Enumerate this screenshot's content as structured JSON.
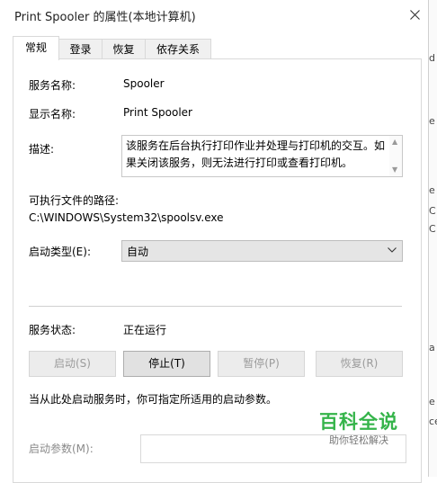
{
  "window": {
    "title": "Print Spooler 的属性(本地计算机)"
  },
  "tabs": [
    {
      "label": "常规",
      "active": true
    },
    {
      "label": "登录",
      "active": false
    },
    {
      "label": "恢复",
      "active": false
    },
    {
      "label": "依存关系",
      "active": false
    }
  ],
  "general": {
    "service_name_label": "服务名称:",
    "service_name": "Spooler",
    "display_name_label": "显示名称:",
    "display_name": "Print Spooler",
    "description_label": "描述:",
    "description": "该服务在后台执行打印作业并处理与打印机的交互。如果关闭该服务，则无法进行打印或查看打印机。",
    "exec_path_label": "可执行文件的路径:",
    "exec_path": "C:\\WINDOWS\\System32\\spoolsv.exe",
    "startup_type_label": "启动类型(E):",
    "startup_type": "自动",
    "status_label": "服务状态:",
    "status": "正在运行",
    "buttons": {
      "start": "启动(S)",
      "stop": "停止(T)",
      "pause": "暂停(P)",
      "resume": "恢复(R)"
    },
    "hint": "当从此处启动服务时，你可指定所适用的启动参数。",
    "params_label": "启动参数(M):",
    "params_value": ""
  },
  "watermark": {
    "title": "百科全说",
    "subtitle": "助你轻松解决"
  },
  "background_fragments": [
    "d",
    "e",
    "e",
    "C",
    "C",
    "a",
    "e",
    "ce"
  ],
  "colors": {
    "accent_green": "#35b44a",
    "tab_active_bg": "#ffffff",
    "button_bg": "#e1e1e1"
  }
}
